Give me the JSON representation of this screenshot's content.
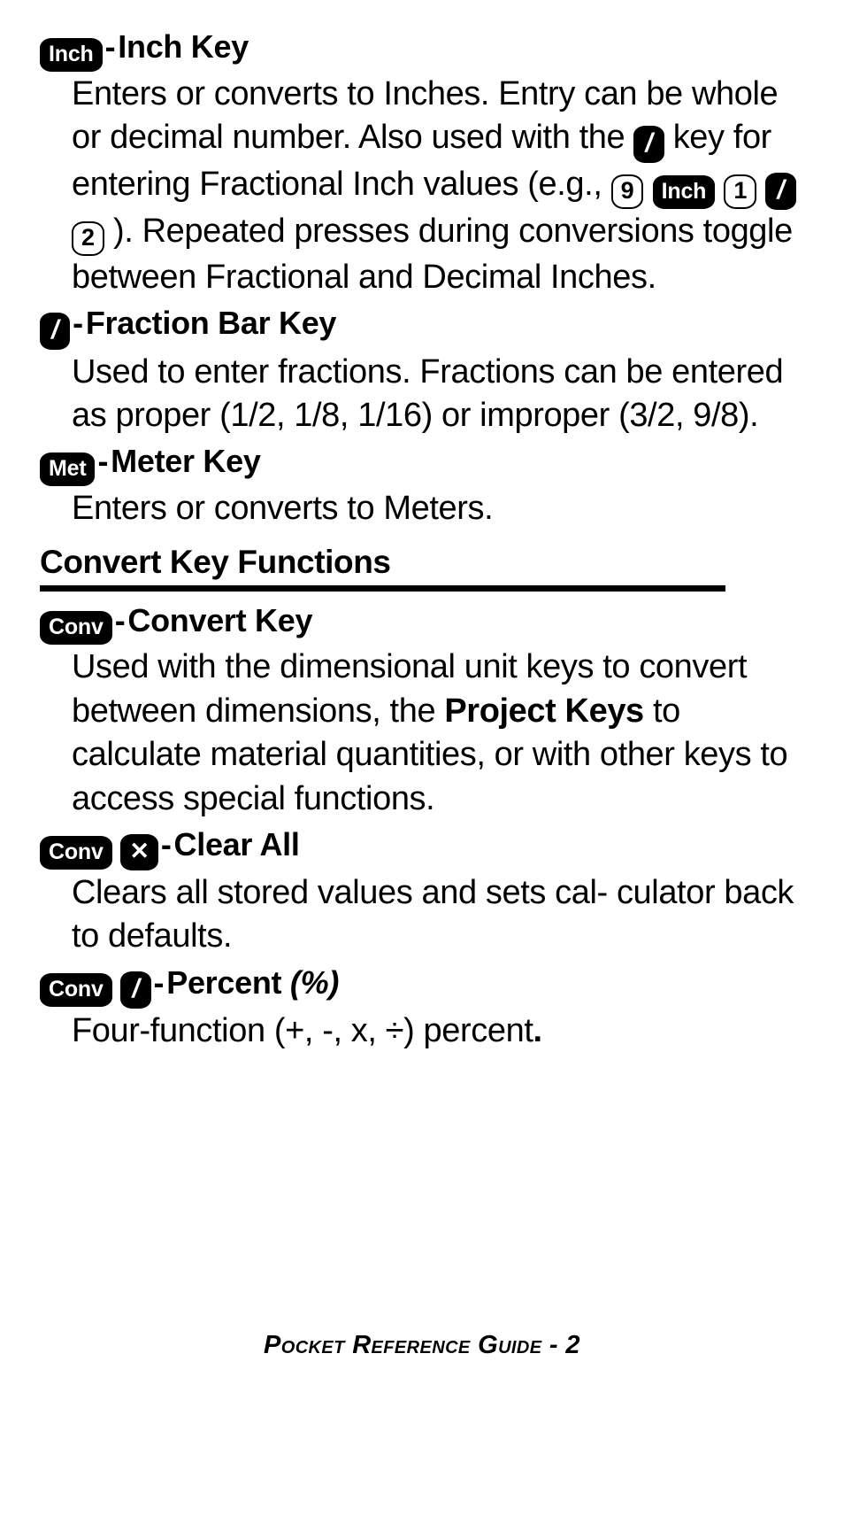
{
  "document": {
    "type": "pocket-reference-guide",
    "page_number": "2",
    "footer_text": "Pocket Reference Guide - 2"
  },
  "entries": [
    {
      "id": "inch-key",
      "key_badges": [
        {
          "type": "filled",
          "label": "Inch"
        }
      ],
      "separator": "-",
      "title": "Inch Key",
      "body_lines": [
        "Enters or converts to Inches. Entry",
        "can be whole or decimal number.",
        "Also used with the",
        "key for entering",
        "Fractional Inch values (e.g.,",
        "). Repeated presses during",
        "conversions toggle between",
        "Fractional and Decimal Inches."
      ],
      "inline_badges": {
        "slash": "/",
        "nine": "9",
        "inch": "Inch",
        "one": "1",
        "two": "2"
      }
    },
    {
      "id": "fraction-bar-key",
      "key_badges": [
        {
          "type": "filled-slash",
          "label": "/"
        }
      ],
      "separator": "-",
      "title": "Fraction Bar Key",
      "body_lines": [
        "Used to enter fractions. Fractions",
        "can be entered as proper (1/2, 1/8,",
        "1/16) or improper (3/2, 9/8)."
      ]
    },
    {
      "id": "meter-key",
      "key_badges": [
        {
          "type": "filled",
          "label": "Met"
        }
      ],
      "separator": "-",
      "title": "Meter Key",
      "body_lines": [
        "Enters or converts to Meters."
      ]
    }
  ],
  "section": {
    "id": "convert-key-functions",
    "title": "Convert Key Functions"
  },
  "convert_entries": [
    {
      "id": "convert-key",
      "key_badges": [
        {
          "type": "filled",
          "label": "Conv"
        }
      ],
      "separator": "-",
      "title": "Convert Key",
      "body_segments": {
        "line1": "Used with the dimensional unit keys",
        "line2": "to convert between dimensions, the",
        "bold_phrase": "Project Keys",
        "line3_rest": " to calculate material",
        "line4": "quantities, or with other keys to",
        "line5": "access special functions."
      }
    },
    {
      "id": "clear-all",
      "key_badges": [
        {
          "type": "filled",
          "label": "Conv"
        },
        {
          "type": "filled-x",
          "label": "✕"
        }
      ],
      "separator": "-",
      "title": "Clear All",
      "body_lines": [
        "Clears all stored values and sets cal-",
        "culator back to defaults."
      ]
    },
    {
      "id": "percent",
      "key_badges": [
        {
          "type": "filled",
          "label": "Conv"
        },
        {
          "type": "filled-slash",
          "label": "/"
        }
      ],
      "separator": "-",
      "title": "Percent",
      "title_italic_suffix": "(%)",
      "body_prefix": "Four-function (+, -, x, ÷) percent",
      "body_suffix": "."
    }
  ],
  "colors": {
    "ink": "#000000",
    "paper": "#ffffff",
    "keycap_fill": "#000000",
    "keycap_text": "#ffffff"
  }
}
